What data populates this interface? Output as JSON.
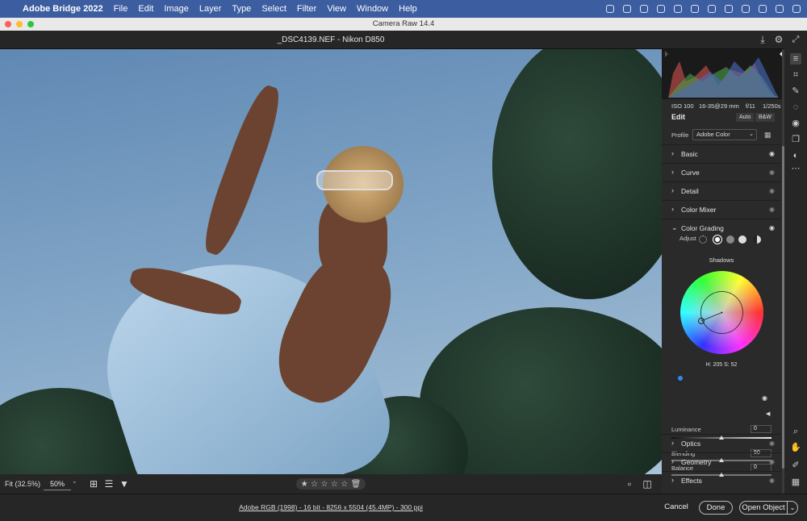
{
  "menubar": {
    "apple": "",
    "app_name": "Adobe Bridge 2022",
    "items": [
      "File",
      "Edit",
      "Image",
      "Layer",
      "Type",
      "Select",
      "Filter",
      "View",
      "Window",
      "Help"
    ]
  },
  "window": {
    "title": "Camera Raw 14.4"
  },
  "document": {
    "filename": "_DSC4139.NEF  -  Nikon D850"
  },
  "exif": {
    "iso": "ISO 100",
    "lens": "16-35@29 mm",
    "aperture": "f/11",
    "shutter": "1/250s"
  },
  "edit": {
    "title": "Edit",
    "auto": "Auto",
    "bw": "B&W"
  },
  "profile": {
    "label": "Profile",
    "value": "Adobe Color"
  },
  "sections_top": [
    {
      "label": "Basic",
      "eye_active": true
    },
    {
      "label": "Curve",
      "eye_active": false
    },
    {
      "label": "Detail",
      "eye_active": false
    },
    {
      "label": "Color Mixer",
      "eye_active": false
    }
  ],
  "color_grading": {
    "label": "Color Grading",
    "adjust_label": "Adjust",
    "wheel_title": "Shadows",
    "hs_readout": "H: 205  S: 52",
    "luminance_label": "Luminance",
    "luminance_value": "0",
    "blending_label": "Blending",
    "blending_value": "50",
    "balance_label": "Balance",
    "balance_value": "0"
  },
  "sections_bottom": [
    {
      "label": "Optics"
    },
    {
      "label": "Geometry"
    },
    {
      "label": "Effects"
    }
  ],
  "bottombar": {
    "fit_label": "Fit (32.5%)",
    "zoom_value": "50%"
  },
  "rating": {
    "stars": 0,
    "max": 5
  },
  "status": {
    "info": "Adobe RGB (1998) - 16 bit - 8256 x 5504 (45.4MP) - 300 ppi"
  },
  "buttons": {
    "cancel": "Cancel",
    "done": "Done",
    "open_object": "Open Object"
  },
  "colors": {
    "menubar": "#3c5da0",
    "panel": "#2a2a2a",
    "accent": "#2d8ceb"
  }
}
